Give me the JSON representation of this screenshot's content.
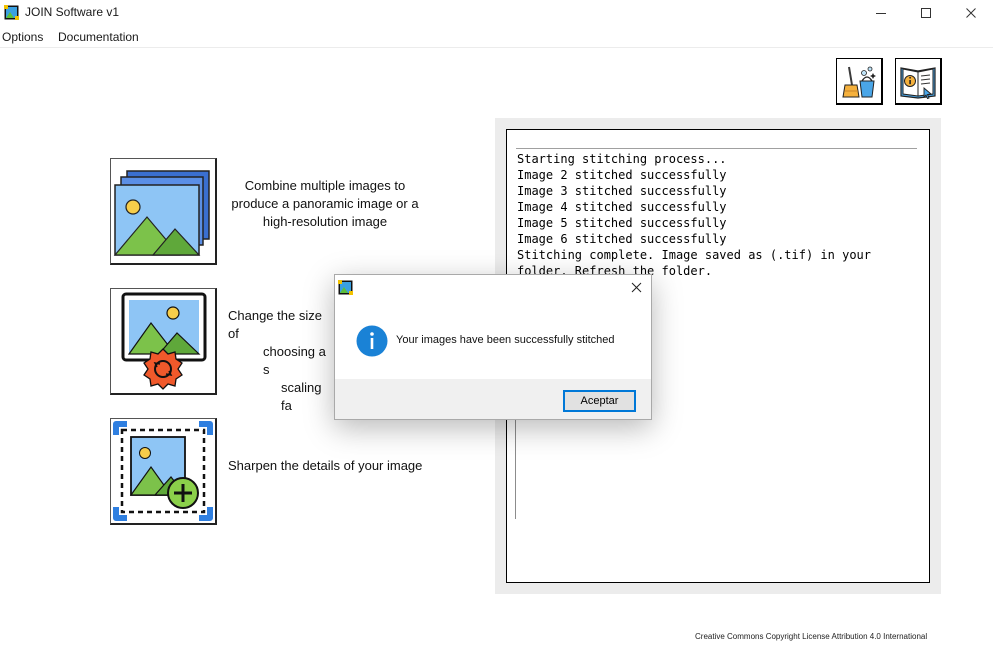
{
  "window": {
    "title": "JOIN Software v1"
  },
  "menu": {
    "options": "Options",
    "documentation": "Documentation"
  },
  "features": [
    {
      "description_lines": [
        "Combine multiple images to",
        "produce a panoramic image or a",
        "high-resolution image"
      ]
    },
    {
      "description_lines": [
        "Change the size of",
        "choosing a s",
        "scaling fa"
      ]
    },
    {
      "description_lines": [
        "Sharpen the details of your image"
      ]
    }
  ],
  "log": {
    "text": "Starting stitching process...\nImage 2 stitched successfully\nImage 3 stitched successfully\nImage 4 stitched successfully\nImage 5 stitched successfully\nImage 6 stitched successfully\nStitching complete. Image saved as (.tif) in your folder. Refresh the folder."
  },
  "footer": {
    "license": "Creative Commons Copyright License Attribution 4.0 International"
  },
  "dialog": {
    "message": "Your images have been successfully stitched",
    "ok_label": "Aceptar"
  },
  "icons": {
    "app": "app-icon",
    "minimize": "minimize-icon",
    "maximize": "maximize-icon",
    "close": "close-icon",
    "clean": "broom-bucket-icon",
    "docs": "info-book-icon",
    "stitch": "image-stack-icon",
    "resize": "image-resize-gear-icon",
    "sharpen": "image-sharpen-plus-icon",
    "info": "info-icon"
  },
  "colors": {
    "accent": "#0078d7",
    "info_blue": "#1a82d6",
    "log_frame": "#ececec"
  }
}
